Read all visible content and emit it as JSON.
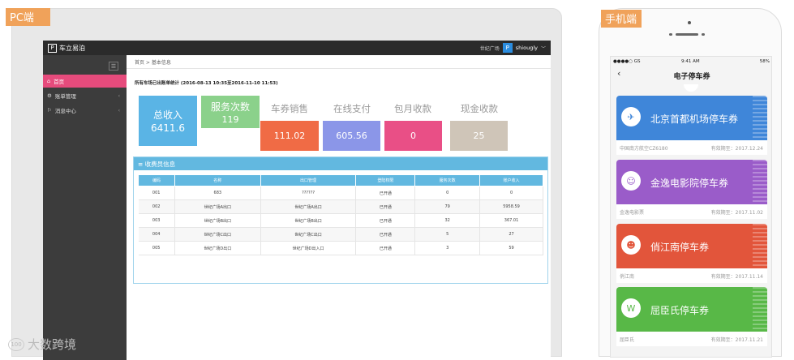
{
  "labels": {
    "pc": "PC端",
    "mobile": "手机端"
  },
  "pc": {
    "logo_text": "车立易泊",
    "header": {
      "location": "世纪广场",
      "user_icon_letter": "P",
      "username": "shiougly"
    },
    "sidebar": {
      "items": [
        {
          "label": "首页",
          "active": true
        },
        {
          "label": "账单管理",
          "active": false
        },
        {
          "label": "消息中心",
          "active": false
        }
      ]
    },
    "breadcrumb": "首页 > 基本信息",
    "stat_line": "所有车场已出账单统计 (2016-08-13 10:35至2016-11-10 11:53)",
    "summary": {
      "total_income": {
        "title": "总收入",
        "value": "6411.6"
      },
      "service_count": {
        "title": "服务次数",
        "value": "119"
      },
      "coupon_sales": {
        "title": "车券销售",
        "value": "111.02"
      },
      "online_pay": {
        "title": "在线支付",
        "value": "605.56"
      },
      "monthly": {
        "title": "包月收款",
        "value": "0"
      },
      "cash": {
        "title": "现金收款",
        "value": "25"
      }
    },
    "colors": {
      "coupon": "#f06b45",
      "online": "#8b96e8",
      "monthly": "#e94f86",
      "cash": "#cfc5b8",
      "accent": "#62b8e0",
      "active": "#e64b7c"
    },
    "panel": {
      "title": "收费员信息",
      "columns": [
        "编码",
        "名称",
        "出口管理",
        "登陆权限",
        "服务次数",
        "账户收入"
      ],
      "rows": [
        [
          "001",
          "683",
          "??????",
          "已开通",
          "0",
          "0"
        ],
        [
          "002",
          "世纪广场A出口",
          "世纪广场A出口",
          "已开通",
          "79",
          "5958.59"
        ],
        [
          "003",
          "世纪广场B出口",
          "世纪广场B出口",
          "已开通",
          "32",
          "367.01"
        ],
        [
          "004",
          "世纪广场C出口",
          "世纪广场C出口",
          "已开通",
          "5",
          "27"
        ],
        [
          "005",
          "世纪广场D出口",
          "世纪广场D出入口",
          "已开通",
          "3",
          "59"
        ]
      ]
    }
  },
  "mobile": {
    "status": {
      "carrier": "●●●●○ GS",
      "time": "9:41 AM",
      "battery": "58%"
    },
    "title": "电子停车券",
    "back": "‹",
    "cards": [
      {
        "name": "北京首都机场停车券",
        "issuer": "中国南方航空CZ6180",
        "expiry": "有效期至：2017.12.24",
        "color": "#3f86d9",
        "icon": "✈"
      },
      {
        "name": "金逸电影院停车券",
        "issuer": "金逸电影票",
        "expiry": "有效期至：2017.11.02",
        "color": "#9a5cc9",
        "icon": "☺"
      },
      {
        "name": "俏江南停车券",
        "issuer": "俏江南",
        "expiry": "有效期至：2017.11.14",
        "color": "#e2553b",
        "icon": "☻"
      },
      {
        "name": "屈臣氏停车券",
        "issuer": "屈臣氏",
        "expiry": "有效期至：2017.11.21",
        "color": "#58b847",
        "icon": "W"
      }
    ]
  },
  "watermark": "大数跨境"
}
